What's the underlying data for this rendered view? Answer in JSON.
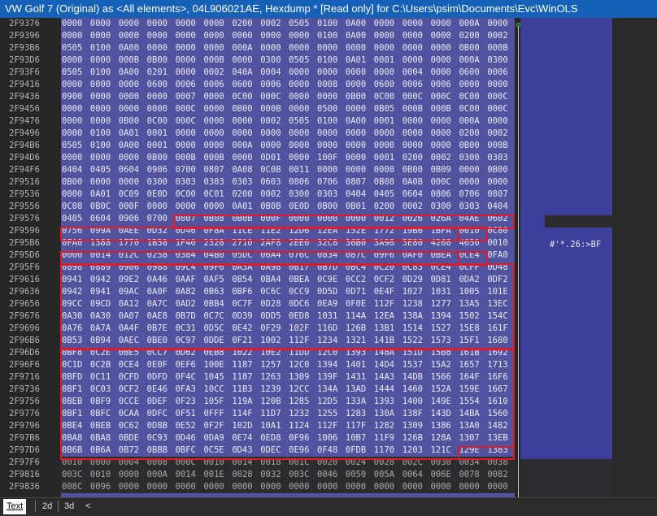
{
  "window": {
    "title": "VW Golf 7 (Original) as <All elements>, 04L906021AE, Hexdump *    [Read only] for C:\\Users\\psim\\Documents\\Evc\\WinOLS"
  },
  "hexdump": {
    "addresses": [
      "2F9376",
      "2F9396",
      "2F93B6",
      "2F93D6",
      "2F93F6",
      "2F9416",
      "2F9436",
      "2F9456",
      "2F9476",
      "2F9496",
      "2F94B6",
      "2F94D6",
      "2F94F6",
      "2F9516",
      "2F9536",
      "2F9556",
      "2F9576",
      "2F9596",
      "2F95B6",
      "2F95D6",
      "2F95F6",
      "2F9616",
      "2F9636",
      "2F9656",
      "2F9676",
      "2F9696",
      "2F96B6",
      "2F96D6",
      "2F96F6",
      "2F9716",
      "2F9736",
      "2F9756",
      "2F9776",
      "2F9796",
      "2F97B6",
      "2F97D6",
      "2F97F6",
      "2F9816",
      "2F9836"
    ],
    "rows": [
      [
        "0000",
        "0000",
        "0000",
        "0000",
        "0000",
        "0000",
        "0200",
        "0002",
        "0505",
        "0100",
        "0A00",
        "0000",
        "0000",
        "0000",
        "000A",
        "0000"
      ],
      [
        "0000",
        "0000",
        "0000",
        "0000",
        "0000",
        "0000",
        "0000",
        "0000",
        "0000",
        "0100",
        "0A00",
        "0000",
        "0000",
        "0000",
        "0200",
        "0002"
      ],
      [
        "0505",
        "0100",
        "0A00",
        "0000",
        "0000",
        "0000",
        "000A",
        "0000",
        "0000",
        "0000",
        "0000",
        "0000",
        "0000",
        "0000",
        "0B00",
        "000B"
      ],
      [
        "0000",
        "0000",
        "000B",
        "0B00",
        "0000",
        "000B",
        "0000",
        "0300",
        "0505",
        "0100",
        "0A01",
        "0001",
        "0000",
        "0000",
        "000A",
        "0300"
      ],
      [
        "0505",
        "0100",
        "0A00",
        "0201",
        "0000",
        "0002",
        "040A",
        "0004",
        "0000",
        "0000",
        "0000",
        "0000",
        "0004",
        "0000",
        "0600",
        "0006"
      ],
      [
        "0000",
        "0000",
        "0000",
        "0600",
        "0006",
        "0006",
        "0600",
        "0006",
        "0000",
        "0008",
        "0000",
        "0600",
        "0006",
        "0006",
        "0000",
        "0000"
      ],
      [
        "0900",
        "0000",
        "0000",
        "0000",
        "0007",
        "0000",
        "0C00",
        "000C",
        "0000",
        "0000",
        "0B00",
        "0C00",
        "000C",
        "000C",
        "0C00",
        "000C"
      ],
      [
        "0000",
        "0000",
        "0000",
        "0000",
        "000C",
        "0000",
        "0B00",
        "000B",
        "0000",
        "0500",
        "0000",
        "0B05",
        "000B",
        "000B",
        "0C00",
        "000C"
      ],
      [
        "0000",
        "0000",
        "0B00",
        "0C00",
        "000C",
        "0000",
        "0000",
        "0002",
        "0505",
        "0100",
        "0A00",
        "0001",
        "0000",
        "0000",
        "000A",
        "0000"
      ],
      [
        "0000",
        "0100",
        "0A01",
        "0001",
        "0000",
        "0000",
        "0000",
        "0000",
        "0000",
        "0000",
        "0000",
        "0000",
        "0000",
        "0000",
        "0200",
        "0002"
      ],
      [
        "0505",
        "0100",
        "0A00",
        "0001",
        "0000",
        "0000",
        "000A",
        "0000",
        "0000",
        "0000",
        "0000",
        "0000",
        "0000",
        "0000",
        "0B00",
        "000B"
      ],
      [
        "0000",
        "0000",
        "0000",
        "0B00",
        "000B",
        "000B",
        "0000",
        "0D01",
        "0000",
        "100F",
        "0000",
        "0001",
        "0200",
        "0002",
        "0300",
        "0303"
      ],
      [
        "0404",
        "0405",
        "0604",
        "0906",
        "0700",
        "0807",
        "0A08",
        "0C0B",
        "0011",
        "0000",
        "0000",
        "0000",
        "0B00",
        "0B09",
        "0000",
        "0B00"
      ],
      [
        "0B00",
        "0000",
        "0000",
        "0300",
        "0303",
        "0303",
        "0303",
        "0603",
        "0806",
        "0706",
        "0807",
        "0B08",
        "0A0B",
        "000C",
        "0000",
        "0000"
      ],
      [
        "0000",
        "0A01",
        "0C09",
        "0E0D",
        "0C00",
        "0C01",
        "0200",
        "0002",
        "0300",
        "0303",
        "0404",
        "0405",
        "0604",
        "0806",
        "0706",
        "0807"
      ],
      [
        "0C08",
        "0B0C",
        "000F",
        "0000",
        "0000",
        "0000",
        "0A01",
        "0B0B",
        "0E0D",
        "0B00",
        "0B01",
        "0200",
        "0002",
        "0300",
        "0303",
        "0404"
      ],
      [
        "0405",
        "0604",
        "0906",
        "0700",
        "0807",
        "0B08",
        "0B0B",
        "000F",
        "0000",
        "0000",
        "0000",
        "0012",
        "0026",
        "026A",
        "04AE",
        "0602"
      ],
      [
        "0756",
        "099A",
        "0AEE",
        "0D32",
        "0D46",
        "0F8A",
        "11CE",
        "11E2",
        "12D6",
        "12EA",
        "152E",
        "1772",
        "19B6",
        "1BFA",
        "0010",
        "0C80"
      ],
      [
        "0FA0",
        "1388",
        "1770",
        "1B58",
        "1F40",
        "2328",
        "2710",
        "2AF8",
        "2EE0",
        "32C8",
        "36B0",
        "3A98",
        "3E80",
        "4268",
        "4650",
        "0010"
      ],
      [
        "0000",
        "0014",
        "012C",
        "0258",
        "0384",
        "04B0",
        "05DC",
        "06A4",
        "076C",
        "0834",
        "087C",
        "09F6",
        "0AF0",
        "0BEA",
        "0CE4",
        "0FA0"
      ],
      [
        "0898",
        "0889",
        "0906",
        "0988",
        "09C4",
        "09F6",
        "0A3A",
        "0A98",
        "0B17",
        "0B7D",
        "0BC4",
        "0C20",
        "0C83",
        "0CE4",
        "0CFF",
        "0D48"
      ],
      [
        "0941",
        "0942",
        "09E2",
        "0A46",
        "0AAF",
        "0AF5",
        "0B54",
        "0BA4",
        "0BEA",
        "0C9E",
        "0CC2",
        "0CF2",
        "0D29",
        "0D81",
        "0DA2",
        "0DF2"
      ],
      [
        "0942",
        "0941",
        "09AC",
        "0A0F",
        "0A82",
        "0B63",
        "0BF6",
        "0C6C",
        "0CC9",
        "0D5D",
        "0D71",
        "0E4F",
        "1027",
        "1031",
        "1005",
        "101E"
      ],
      [
        "09CC",
        "09CD",
        "0A12",
        "0A7C",
        "0AD2",
        "0BB4",
        "0C7F",
        "0D28",
        "0DC6",
        "0EA9",
        "0F0E",
        "112F",
        "1238",
        "1277",
        "13A5",
        "13EC"
      ],
      [
        "0A30",
        "0A30",
        "0A07",
        "0AE8",
        "0B7D",
        "0C7C",
        "0D39",
        "0DD5",
        "0ED8",
        "1031",
        "114A",
        "12EA",
        "138A",
        "1394",
        "1502",
        "154C"
      ],
      [
        "0A76",
        "0A7A",
        "0A4F",
        "0B7E",
        "0C31",
        "0D5C",
        "0E42",
        "0F29",
        "102F",
        "116D",
        "126B",
        "13B1",
        "1514",
        "1527",
        "15E8",
        "161F"
      ],
      [
        "0B53",
        "0B94",
        "0AEC",
        "0BE0",
        "0C97",
        "0DDE",
        "0F21",
        "1002",
        "112F",
        "1234",
        "1321",
        "141B",
        "1522",
        "1573",
        "15F1",
        "1680"
      ],
      [
        "0BF8",
        "0C2E",
        "0BE5",
        "0CC7",
        "0D62",
        "0EB8",
        "1022",
        "10E2",
        "11DD",
        "12C0",
        "1393",
        "148A",
        "151D",
        "15B8",
        "161B",
        "1692"
      ],
      [
        "0C1D",
        "0C2B",
        "0CE4",
        "0E0F",
        "0EF6",
        "100E",
        "1187",
        "1257",
        "12C0",
        "1394",
        "1401",
        "14D4",
        "1537",
        "15A2",
        "1657",
        "1713"
      ],
      [
        "0BFD",
        "0C11",
        "0CFD",
        "0DFD",
        "0F4C",
        "1045",
        "1187",
        "1263",
        "1309",
        "139F",
        "1431",
        "14A3",
        "14DB",
        "1566",
        "164F",
        "16F6"
      ],
      [
        "0BF1",
        "0C03",
        "0CF2",
        "0E46",
        "0FA3",
        "10CC",
        "11B3",
        "1239",
        "12CC",
        "134A",
        "13AD",
        "1444",
        "1460",
        "152A",
        "159E",
        "1667"
      ],
      [
        "0BEB",
        "0BF9",
        "0CCE",
        "0DEF",
        "0F23",
        "105F",
        "119A",
        "120B",
        "1285",
        "12D5",
        "133A",
        "1393",
        "1400",
        "149E",
        "1554",
        "1610"
      ],
      [
        "0BF1",
        "0BFC",
        "0CAA",
        "0DFC",
        "0F51",
        "0FFF",
        "114F",
        "11D7",
        "1232",
        "1255",
        "1283",
        "130A",
        "138F",
        "143D",
        "14BA",
        "1560"
      ],
      [
        "0BE4",
        "0BEB",
        "0C62",
        "0D8B",
        "0E52",
        "0F2F",
        "102D",
        "10A1",
        "1124",
        "112F",
        "117F",
        "1282",
        "1309",
        "1386",
        "13A0",
        "1482"
      ],
      [
        "0BA8",
        "0BA8",
        "0BDE",
        "0C93",
        "0D46",
        "0DA9",
        "0E74",
        "0ED8",
        "0F96",
        "1006",
        "10B7",
        "11F9",
        "126B",
        "128A",
        "1307",
        "13EB"
      ],
      [
        "0B6B",
        "0B6A",
        "0B72",
        "0BBB",
        "0BFC",
        "0C5E",
        "0D43",
        "0DEC",
        "0E96",
        "0F48",
        "0FDB",
        "1170",
        "1203",
        "121C",
        "129E",
        "1383"
      ],
      [
        "0010",
        "0000",
        "0004",
        "0008",
        "000C",
        "0010",
        "0014",
        "0018",
        "001C",
        "0020",
        "0024",
        "0028",
        "002C",
        "0030",
        "0034",
        "0038"
      ],
      [
        "003C",
        "0010",
        "0000",
        "000A",
        "0014",
        "001E",
        "0028",
        "0032",
        "003C",
        "0046",
        "0050",
        "005A",
        "0064",
        "006E",
        "0078",
        "0082"
      ],
      [
        "008C",
        "0096",
        "0000",
        "0000",
        "0000",
        "0000",
        "0000",
        "0000",
        "0000",
        "0000",
        "0000",
        "0000",
        "0000",
        "0000",
        "0000",
        "0000"
      ]
    ]
  },
  "ascii": {
    "visible_text": "#'*.26:>BF"
  },
  "tabs": [
    {
      "label": "Text",
      "active": true
    },
    {
      "label": "2d",
      "active": false
    },
    {
      "label": "3d",
      "active": false
    },
    {
      "label": "<",
      "active": false
    }
  ],
  "colors": {
    "selection_border": "#e01a26",
    "hex_background": "#52539f",
    "title_bar": "#1561b8"
  }
}
